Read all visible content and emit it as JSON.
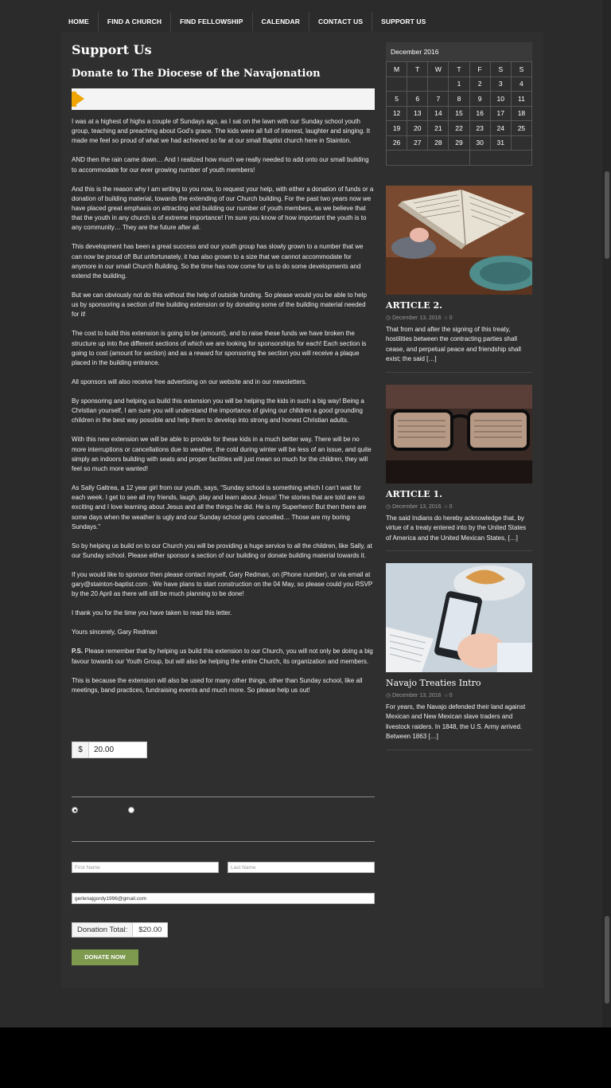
{
  "nav": {
    "items": [
      "HOME",
      "FIND A CHURCH",
      "FIND FELLOWSHIP",
      "CALENDAR",
      "CONTACT US",
      "SUPPORT US"
    ]
  },
  "page": {
    "title": "Support Us",
    "subtitle": "Donate to The Diocese of the Navajonation",
    "paragraphs": [
      "I was at a highest of highs a couple of Sundays ago, as I sat on the lawn with our Sunday school youth group, teaching and preaching about God’s grace. The kids were all full of interest, laughter and singing. It made me feel so proud of what we had achieved so far at our small Baptist church here in Stainton.",
      "AND then the rain came down… And I realized how much we really needed to add onto our small building to accommodate for our ever growing number of youth members!",
      "And this is the reason why I am writing to you now, to request your help, with either a donation of funds or a donation of building material, towards the extending of our Church building. For the past two years now we have placed great emphasis on attracting and building our number of youth members, as we believe that that the youth in any church is of extreme importance! I’m sure you know of how important the youth is to any community… They are the future after all.",
      "This development has been a great success and our youth group has slowly grown to a number that we can now be proud of! But unfortunately, it has also grown to a size that we cannot accommodate for anymore in our small Church Building. So the time has now come for us to do some developments and extend the building.",
      "But we can obviously not do this without the help of outside funding. So please would you be able to help us by sponsoring a section of the building extension or by donating some of the building material needed for it!",
      "The cost to build this extension is going to be (amount), and to raise these funds we have broken the structure up into five different sections of which we are looking for sponsorships for each! Each section is going to cost (amount for section) and as a reward for sponsoring the section you will receive a plaque placed in the building entrance.",
      "All sponsors will also receive free advertising on our website and in our newsletters.",
      "By sponsoring and helping us build this extension you will be helping the kids in such a big way! Being a Christian yourself, I am sure you will understand the importance of giving our children a good grounding children in the best way possible and help them to develop into strong and honest Christian adults.",
      "With this new extension we will be able to provide for these kids in a much better way. There will be no more interruptions or cancellations due to weather, the cold during winter will be less of an issue, and quite simply an indoors building with seats and proper facilities will just mean so much for the children, they will feel so much more wanted!",
      "As Sally Galtrea, a 12 year girl from our youth, says, “Sunday school is something which I can’t wait for each week. I get to see all my friends, laugh, play and learn about Jesus! The stories that are told are so exciting and I love learning about Jesus and all the things he did. He is my Superhero! But then there are some days when the weather is ugly and our Sunday school gets cancelled… Those are my boring Sundays.”",
      "So by helping us build on to our Church you will be providing a huge service to all the children, like Sally, at our Sunday school. Please either sponsor a section of our building or donate building material towards it.",
      "If you would like to sponsor then please contact myself, Gary Redman, on (Phone number), or via email at gary@stainton-baptist.com . We have plans to start construction on the 04 May, so please could you RSVP by the 20 April as there will still be much planning to be done!",
      "I thank you for the time you have taken to read this letter.",
      "Yours sincerely, Gary Redman"
    ],
    "ps_label": "P.S.",
    "ps_text": " Please remember that by helping us build this extension to our Church, you will not only be doing a big favour towards our Youth Group, but will also be helping the entire Church, its organization and members.",
    "closing": "This is because the extension will also be used for many other things, other than Sunday school, like all meetings, band practices, fundraising events and much more. So please help us out!"
  },
  "form": {
    "currency": "$",
    "amount": "20.00",
    "first_name_placeholder": "First Name",
    "last_name_placeholder": "Last Name",
    "email": "gerlenajgordy1996@gmail.com",
    "total_label": "Donation Total:",
    "total_value": "$20.00",
    "donate_label": "DONATE NOW"
  },
  "calendar": {
    "caption": "December 2016",
    "days": [
      "M",
      "T",
      "W",
      "T",
      "F",
      "S",
      "S"
    ],
    "weeks": [
      [
        "",
        "",
        "",
        "1",
        "2",
        "3",
        "4"
      ],
      [
        "5",
        "6",
        "7",
        "8",
        "9",
        "10",
        "11"
      ],
      [
        "12",
        "13",
        "14",
        "15",
        "16",
        "17",
        "18"
      ],
      [
        "19",
        "20",
        "21",
        "22",
        "23",
        "24",
        "25"
      ],
      [
        "26",
        "27",
        "28",
        "29",
        "30",
        "31",
        ""
      ]
    ]
  },
  "posts": [
    {
      "title": "ARTICLE 2.",
      "date": "December 13, 2016",
      "comments": "0",
      "excerpt": "That from and after the signing of this treaty, hostilities between the contracting parties shall cease, and perpetual peace and friendship shall exist; the said",
      "more": "[…]",
      "image_icon": "open-bible-image"
    },
    {
      "title": "ARTICLE 1.",
      "date": "December 13, 2016",
      "comments": "0",
      "excerpt": "The said Indians do hereby acknowledge that, by virtue of a treaty entered into by the United States of America and the United Mexican States,",
      "more": "[…]",
      "image_icon": "reading-glasses-image"
    },
    {
      "title": "Navajo Treaties Intro",
      "date": "December 13, 2016",
      "comments": "0",
      "excerpt": "For years, the Navajo defended their land against Mexican and New Mexican slave traders and livestock raiders. In 1848, the U.S. Army arrived. Between 1863",
      "more": "[…]",
      "image_icon": "smartphone-image"
    }
  ]
}
